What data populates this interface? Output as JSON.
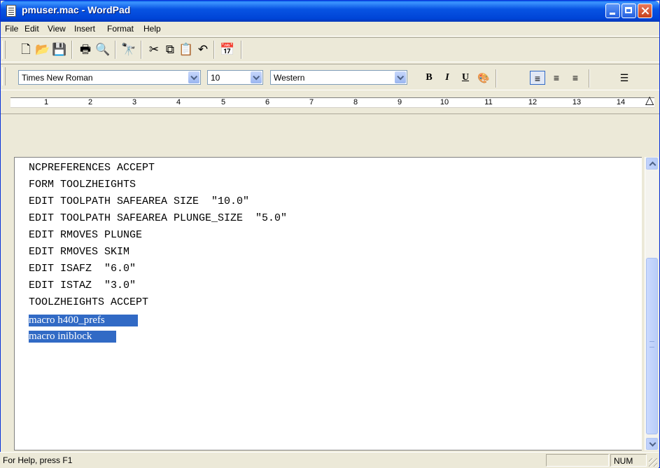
{
  "window": {
    "title": "pmuser.mac - WordPad"
  },
  "menu": [
    "File",
    "Edit",
    "View",
    "Insert",
    "Format",
    "Help"
  ],
  "toolbar": {
    "icons": [
      "new-icon",
      "open-icon",
      "save-icon",
      "print-icon",
      "print-preview-icon",
      "find-icon",
      "cut-icon",
      "copy-icon",
      "paste-icon",
      "undo-icon",
      "date-time-icon"
    ]
  },
  "format": {
    "font": "Times New Roman",
    "size": "10",
    "script": "Western",
    "bold_label": "B",
    "italic_label": "I",
    "underline_label": "U"
  },
  "ruler": {
    "numbers": [
      "1",
      "2",
      "3",
      "4",
      "5",
      "6",
      "7",
      "8",
      "9",
      "10",
      "11",
      "12",
      "13",
      "14"
    ]
  },
  "document": {
    "lines": [
      "NCPREFERENCES ACCEPT",
      "FORM TOOLZHEIGHTS",
      "EDIT TOOLPATH SAFEAREA SIZE  \"10.0\"",
      "EDIT TOOLPATH SAFEAREA PLUNGE_SIZE  \"5.0\"",
      "EDIT RMOVES PLUNGE",
      "EDIT RMOVES SKIM",
      "EDIT ISAFZ  \"6.0\"",
      "EDIT ISTAZ  \"3.0\"",
      "TOOLZHEIGHTS ACCEPT"
    ],
    "selected_lines": [
      "macro h400_prefs",
      "macro iniblock"
    ]
  },
  "status": {
    "help": "For Help, press F1",
    "num": "NUM"
  },
  "colors": {
    "titlebar": "#0054e3",
    "selection": "#316ac5",
    "chrome": "#ece9d8"
  }
}
